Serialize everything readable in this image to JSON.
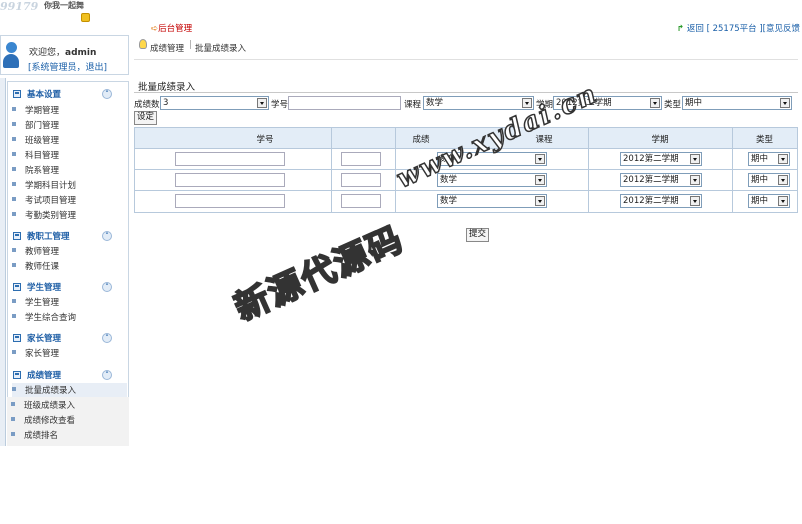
{
  "header": {
    "logo_text": "99179",
    "logo_slogan": "你我一起舞",
    "home_link": "后台管理",
    "back_label": "返回",
    "platform_label": "[ 25175平台 ]",
    "feedback_label": "[意见反馈"
  },
  "user": {
    "welcome_prefix": "欢迎您，",
    "username": "admin",
    "role_line": "[系统管理员，退出]"
  },
  "breadcrumb": {
    "items": [
      "成绩管理",
      "批量成绩录入"
    ],
    "separator": "|"
  },
  "sidebar": {
    "groups": [
      {
        "label": "基本设置",
        "items": [
          "学期管理",
          "部门管理",
          "班级管理",
          "科目管理",
          "院系管理",
          "学期科目计划",
          "考试项目管理",
          "考勤类别管理"
        ]
      },
      {
        "label": "教职工管理",
        "items": [
          "教师管理",
          "教师任课"
        ]
      },
      {
        "label": "学生管理",
        "items": [
          "学生管理",
          "学生综合查询"
        ]
      },
      {
        "label": "家长管理",
        "items": [
          "家长管理"
        ]
      },
      {
        "label": "成绩管理",
        "items": [
          "批量成绩录入",
          "班级成绩录入",
          "成绩修改查看",
          "成绩排名"
        ]
      }
    ],
    "active_item": "批量成绩录入"
  },
  "panel": {
    "title": "批量成绩录入"
  },
  "filters": {
    "count_label": "成绩数",
    "count_value": "3",
    "student_id_label": "学号",
    "student_id_value": "",
    "course_label": "课程",
    "course_value": "数学",
    "term_label": "学期",
    "term_value": "2012第二学期",
    "type_label": "类型",
    "type_value": "期中",
    "set_button": "设定"
  },
  "grid": {
    "columns": [
      "学号",
      "成绩",
      "课程",
      "学期",
      "类型"
    ],
    "rows": [
      {
        "student_id": "",
        "score": "",
        "course": "数学",
        "term": "2012第二学期",
        "type": "期中"
      },
      {
        "student_id": "",
        "score": "",
        "course": "数学",
        "term": "2012第二学期",
        "type": "期中"
      },
      {
        "student_id": "",
        "score": "",
        "course": "数学",
        "term": "2012第二学期",
        "type": "期中"
      }
    ]
  },
  "submit_label": "提交",
  "watermark": {
    "cn": "新源代源码",
    "en": "www.xydai.cn"
  },
  "colors": {
    "accent_blue": "#1f5fa6",
    "header_red": "#c40000",
    "grid_header_bg": "#e3edf7"
  }
}
